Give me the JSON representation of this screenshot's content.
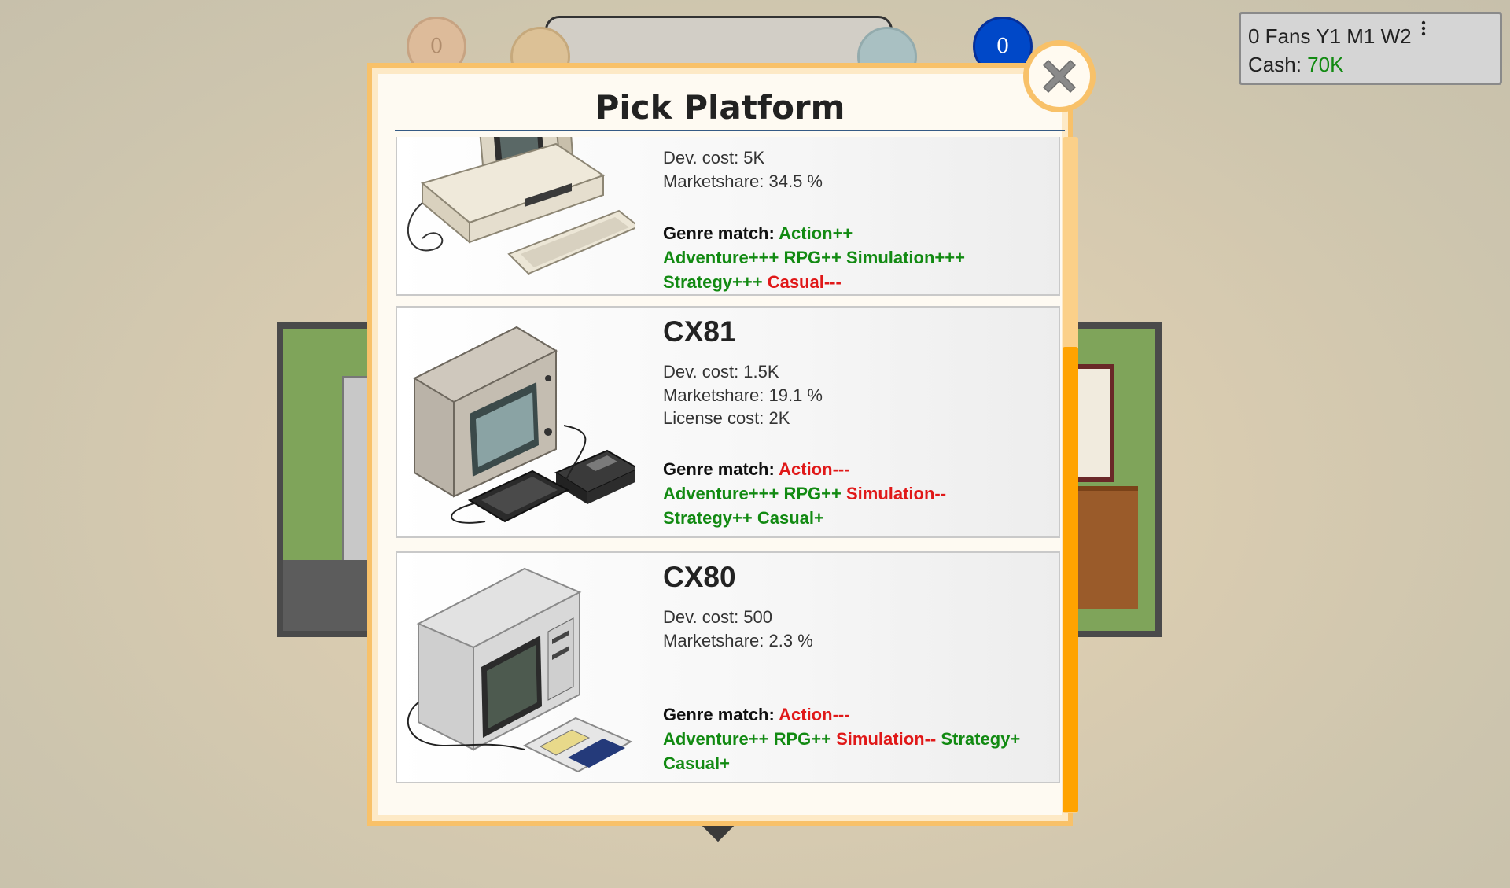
{
  "hud": {
    "circle_1": "0",
    "circle_4": "0"
  },
  "status": {
    "fans_date": "0 Fans Y1 M1 W2",
    "cash_label": "Cash: ",
    "cash_value": "70K",
    "more_icon": "vertical-ellipsis-icon"
  },
  "dialog": {
    "title": "Pick Platform",
    "close_icon": "close-x-icon",
    "platforms": [
      {
        "name": "",
        "stats": [
          "Dev. cost: 5K",
          "Marketshare: 34.5 %"
        ],
        "genre_label": "Genre match: ",
        "genres": [
          {
            "text": "Action++",
            "sign": "plus"
          },
          {
            "text": "Adventure+++",
            "sign": "plus"
          },
          {
            "text": "RPG++",
            "sign": "plus"
          },
          {
            "text": "Simulation+++",
            "sign": "plus"
          },
          {
            "text": "Strategy+++",
            "sign": "plus"
          },
          {
            "text": "Casual---",
            "sign": "minus"
          }
        ],
        "image": "pc-computer-icon"
      },
      {
        "name": "CX81",
        "stats": [
          "Dev. cost: 1.5K",
          "Marketshare: 19.1 %",
          "License cost: 2K"
        ],
        "genre_label": "Genre match: ",
        "genres": [
          {
            "text": "Action---",
            "sign": "minus"
          },
          {
            "text": "Adventure+++",
            "sign": "plus"
          },
          {
            "text": "RPG++",
            "sign": "plus"
          },
          {
            "text": "Simulation--",
            "sign": "minus"
          },
          {
            "text": "Strategy++",
            "sign": "plus"
          },
          {
            "text": "Casual+",
            "sign": "plus"
          }
        ],
        "image": "cx81-computer-icon"
      },
      {
        "name": "CX80",
        "stats": [
          "Dev. cost: 500",
          "Marketshare: 2.3 %"
        ],
        "genre_label": "Genre match: ",
        "genres": [
          {
            "text": "Action---",
            "sign": "minus"
          },
          {
            "text": "Adventure++",
            "sign": "plus"
          },
          {
            "text": "RPG++",
            "sign": "plus"
          },
          {
            "text": "Simulation--",
            "sign": "minus"
          },
          {
            "text": "Strategy+",
            "sign": "plus"
          },
          {
            "text": "Casual+",
            "sign": "plus"
          }
        ],
        "image": "cx80-computer-icon"
      }
    ]
  },
  "colors": {
    "positive": "#128a12",
    "negative": "#e01818",
    "dialog_border": "#f8c169",
    "scroll_thumb": "#ffa300",
    "cash": "#128a12"
  }
}
